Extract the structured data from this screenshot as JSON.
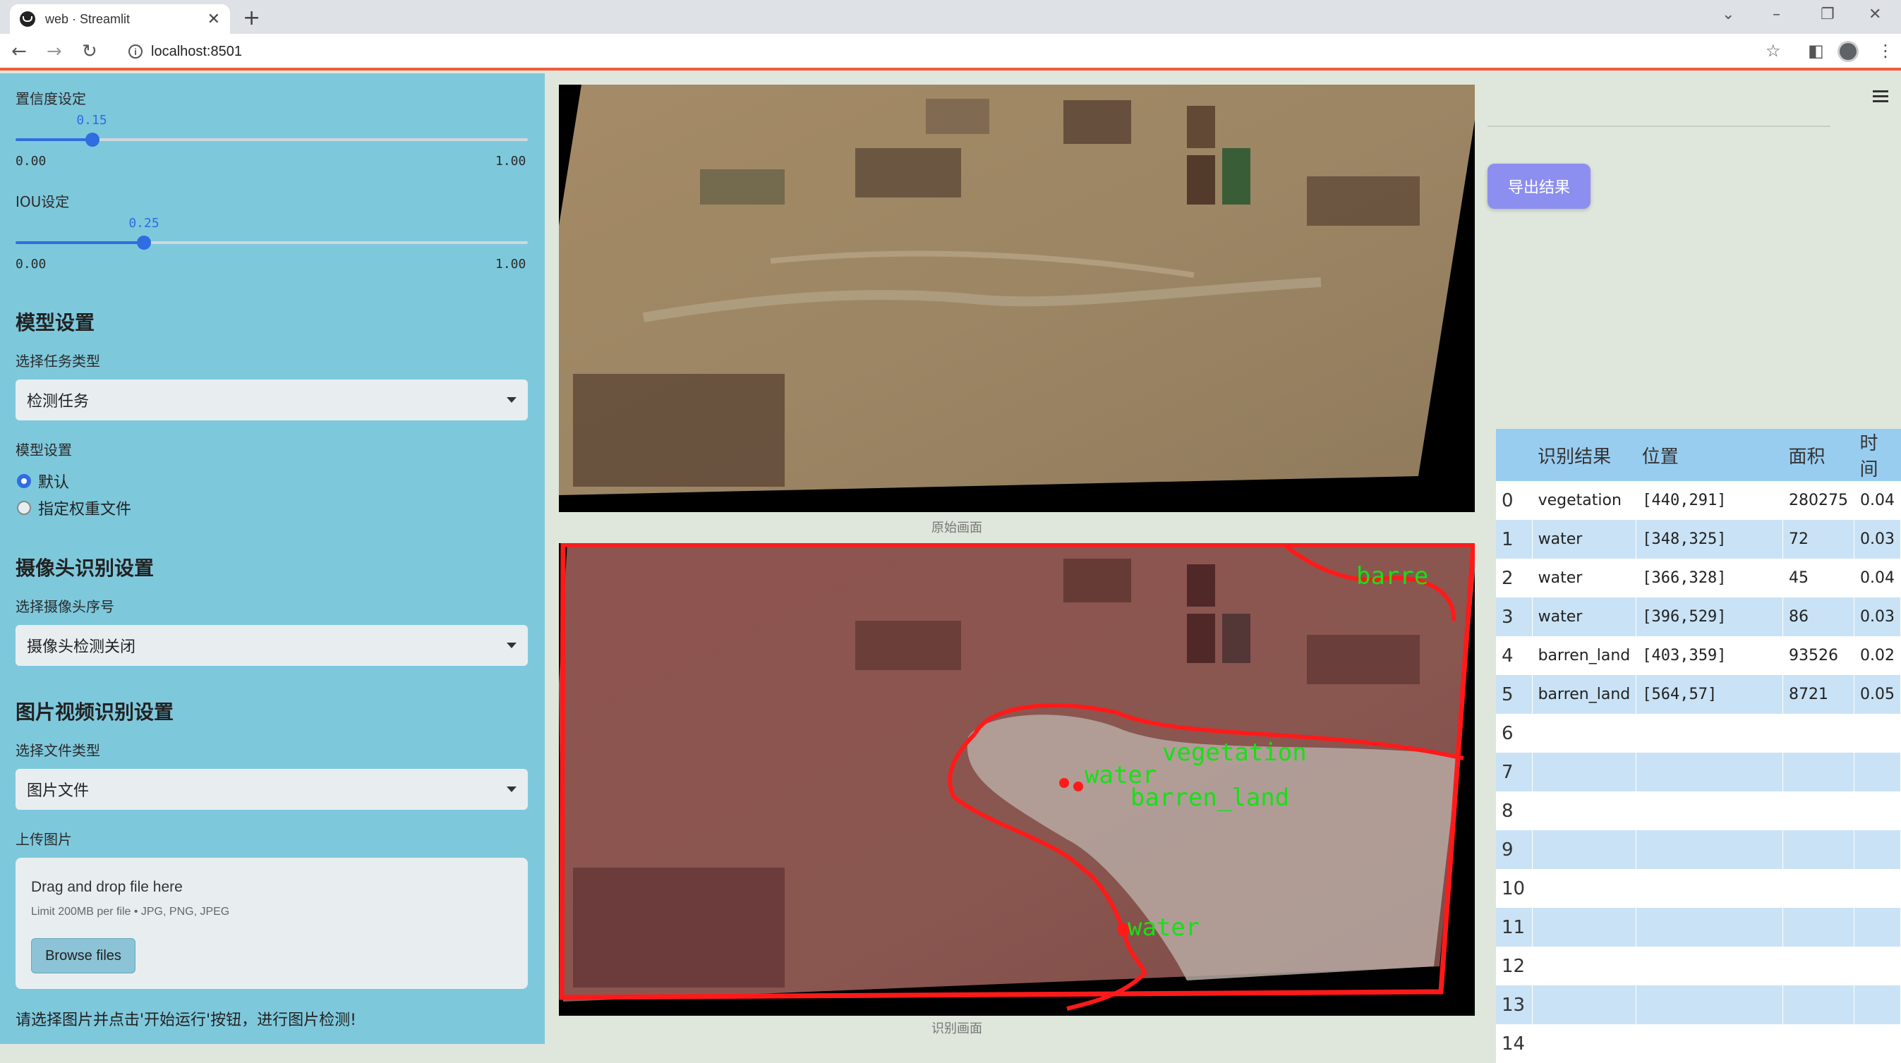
{
  "browser": {
    "tab_title": "web · Streamlit",
    "url": "localhost:8501"
  },
  "sidebar": {
    "conf_label": "置信度设定",
    "conf_value": "0.15",
    "conf_level": 0.15,
    "conf_min": "0.00",
    "conf_max": "1.00",
    "iou_label": "IOU设定",
    "iou_value": "0.25",
    "iou_level": 0.25,
    "iou_min": "0.00",
    "iou_max": "1.00",
    "model_header": "模型设置",
    "task_label": "选择任务类型",
    "task_value": "检测任务",
    "model_label": "模型设置",
    "model_options": [
      "默认",
      "指定权重文件"
    ],
    "camera_header": "摄像头识别设置",
    "camera_label": "选择摄像头序号",
    "camera_value": "摄像头检测关闭",
    "media_header": "图片视频识别设置",
    "filetype_label": "选择文件类型",
    "filetype_value": "图片文件",
    "upload_label": "上传图片",
    "drop_title": "Drag and drop file here",
    "drop_limit": "Limit 200MB per file • JPG, PNG, JPEG",
    "browse_label": "Browse files",
    "hint": "请选择图片并点击'开始运行'按钮，进行图片检测!"
  },
  "main": {
    "original_caption": "原始画面",
    "result_caption": "识别画面",
    "detection_labels": [
      "barre",
      "vegetation",
      "water",
      "barren_land",
      "water"
    ]
  },
  "right": {
    "export_label": "导出结果",
    "table_headers": [
      "",
      "识别结果",
      "位置",
      "面积",
      "时间"
    ],
    "rows": [
      [
        "0",
        "vegetation",
        "[440,291]",
        "280275",
        "0.04"
      ],
      [
        "1",
        "water",
        "[348,325]",
        "72",
        "0.03"
      ],
      [
        "2",
        "water",
        "[366,328]",
        "45",
        "0.04"
      ],
      [
        "3",
        "water",
        "[396,529]",
        "86",
        "0.03"
      ],
      [
        "4",
        "barren_land",
        "[403,359]",
        "93526",
        "0.02"
      ],
      [
        "5",
        "barren_land",
        "[564,57]",
        "8721",
        "0.05"
      ],
      [
        "6",
        "",
        "",
        "",
        ""
      ],
      [
        "7",
        "",
        "",
        "",
        ""
      ],
      [
        "8",
        "",
        "",
        "",
        ""
      ],
      [
        "9",
        "",
        "",
        "",
        ""
      ],
      [
        "10",
        "",
        "",
        "",
        ""
      ],
      [
        "11",
        "",
        "",
        "",
        ""
      ],
      [
        "12",
        "",
        "",
        "",
        ""
      ],
      [
        "13",
        "",
        "",
        "",
        ""
      ],
      [
        "14",
        "",
        "",
        "",
        ""
      ]
    ]
  },
  "colors": {
    "sidebar_bg": "#7ec8dc",
    "accent": "#2f6de0",
    "export_button": "#8c8ff0",
    "detection_box": "#ff0000",
    "detection_text": "#00e000"
  }
}
